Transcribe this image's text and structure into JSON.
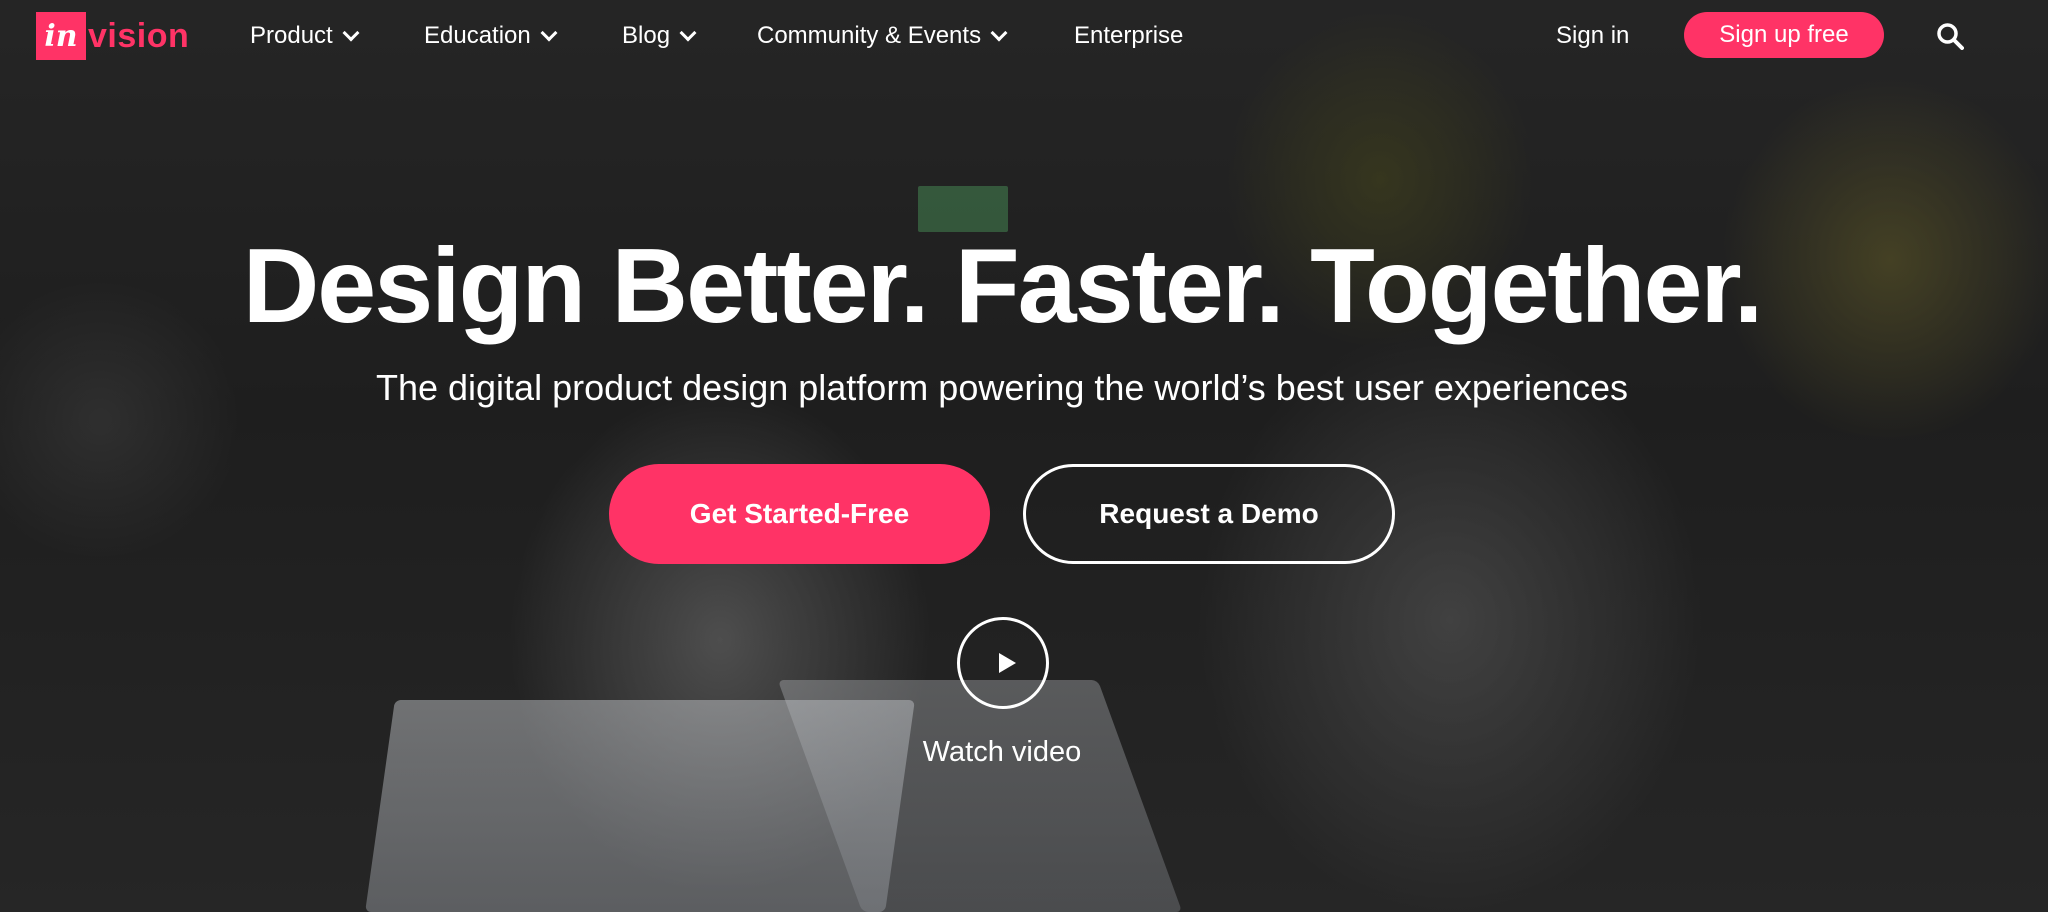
{
  "brand": {
    "logo_mark": "in",
    "logo_word": "vision",
    "accent_color": "#ff3366"
  },
  "nav": {
    "items": [
      {
        "label": "Product",
        "has_dropdown": true
      },
      {
        "label": "Education",
        "has_dropdown": true
      },
      {
        "label": "Blog",
        "has_dropdown": true
      },
      {
        "label": "Community & Events",
        "has_dropdown": true
      },
      {
        "label": "Enterprise",
        "has_dropdown": false
      }
    ],
    "sign_in_label": "Sign in",
    "sign_up_label": "Sign up free",
    "search_icon": "search-icon"
  },
  "hero": {
    "headline": "Design Better. Faster. Together.",
    "subheadline": "The digital product design platform powering the world’s best user experiences",
    "primary_cta_label": "Get Started-Free",
    "secondary_cta_label": "Request a Demo",
    "play_icon": "play-icon",
    "watch_video_label": "Watch video"
  }
}
